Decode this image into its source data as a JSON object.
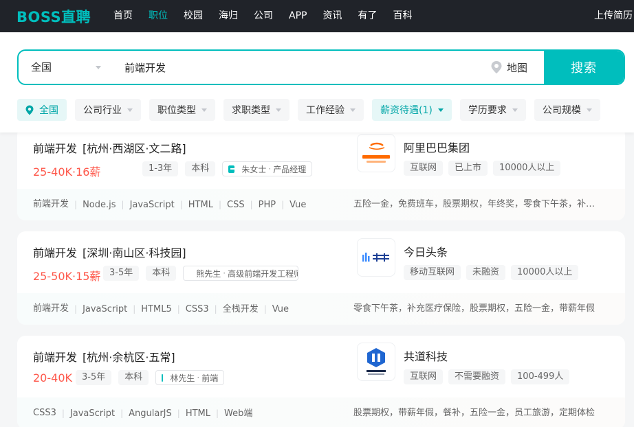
{
  "header": {
    "logo": "BOSS直聘",
    "nav": [
      "首页",
      "职位",
      "校园",
      "海归",
      "公司",
      "APP",
      "资讯",
      "有了",
      "百科"
    ],
    "active_nav": "职位",
    "upload_resume": "上传简历"
  },
  "search": {
    "city": "全国",
    "query": "前端开发",
    "map_label": "地图",
    "button_label": "搜索"
  },
  "filters": {
    "city": "全国",
    "items": [
      "公司行业",
      "职位类型",
      "求职类型",
      "工作经验",
      "薪资待遇(1)",
      "学历要求",
      "公司规模"
    ],
    "active": "薪资待遇(1)"
  },
  "colors": {
    "accent": "#00bebd",
    "salary": "#fe574a",
    "nav_bg": "#202329"
  },
  "jobs": [
    {
      "title": "前端开发",
      "area": "[杭州·西湖区·文二路]",
      "salary": "25-40K·16薪",
      "experience": "1-3年",
      "degree": "本科",
      "boss_name": "朱女士",
      "boss_title": "产品经理",
      "company": "阿里巴巴集团",
      "company_tags": [
        "互联网",
        "已上市",
        "10000人以上"
      ],
      "skills": [
        "前端开发",
        "Node.js",
        "JavaScript",
        "HTML",
        "CSS",
        "PHP",
        "Vue"
      ],
      "welfare": "五险一金，免费班车，股票期权，年终奖，零食下午茶，补充医疗保险",
      "logo_icon": "alibaba-logo"
    },
    {
      "title": "前端开发",
      "area": "[深圳·南山区·科技园]",
      "salary": "25-50K·15薪",
      "experience": "3-5年",
      "degree": "本科",
      "boss_name": "熊先生",
      "boss_title": "高级前端开发工程师",
      "company": "今日头条",
      "company_tags": [
        "移动互联网",
        "未融资",
        "10000人以上"
      ],
      "skills": [
        "前端开发",
        "JavaScript",
        "HTML5",
        "CSS3",
        "全栈开发",
        "Vue"
      ],
      "welfare": "零食下午茶，补充医疗保险，股票期权，五险一金，带薪年假",
      "logo_icon": "bytedance-logo"
    },
    {
      "title": "前端开发",
      "area": "[杭州·余杭区·五常]",
      "salary": "20-40K",
      "experience": "3-5年",
      "degree": "本科",
      "boss_name": "林先生",
      "boss_title": "前端",
      "company": "共道科技",
      "company_tags": [
        "互联网",
        "不需要融资",
        "100-499人"
      ],
      "skills": [
        "CSS3",
        "JavaScript",
        "AngularJS",
        "HTML",
        "Web端"
      ],
      "welfare": "股票期权，带薪年假，餐补，五险一金，员工旅游，定期体检",
      "logo_icon": "gongdao-logo"
    }
  ]
}
